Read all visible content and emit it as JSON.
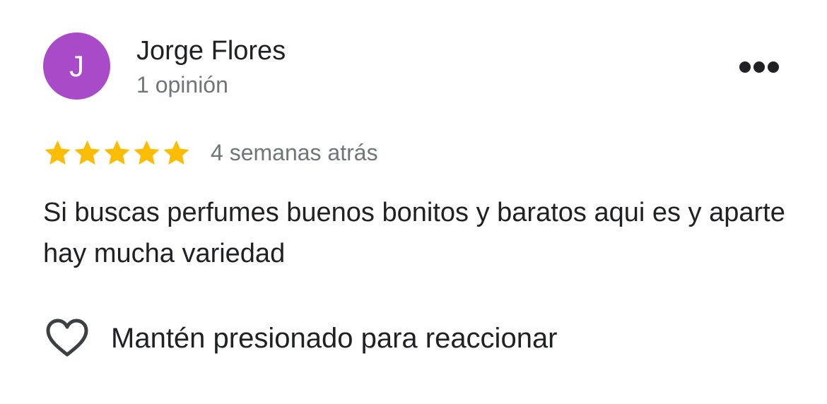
{
  "review": {
    "author": {
      "initial": "J",
      "name": "Jorge Flores",
      "meta": "1 opinión",
      "avatar_color": "#a94ac8"
    },
    "menu_icon": "more-horizontal-icon",
    "rating": {
      "stars": 5,
      "max_stars": 5,
      "star_color": "#fbbc04",
      "date": "4 semanas atrás"
    },
    "text": "Si buscas perfumes buenos bonitos y baratos aqui es y aparte hay mucha variedad",
    "reaction": {
      "icon": "heart-outline-icon",
      "label": "Mantén presionado para reaccionar"
    }
  }
}
